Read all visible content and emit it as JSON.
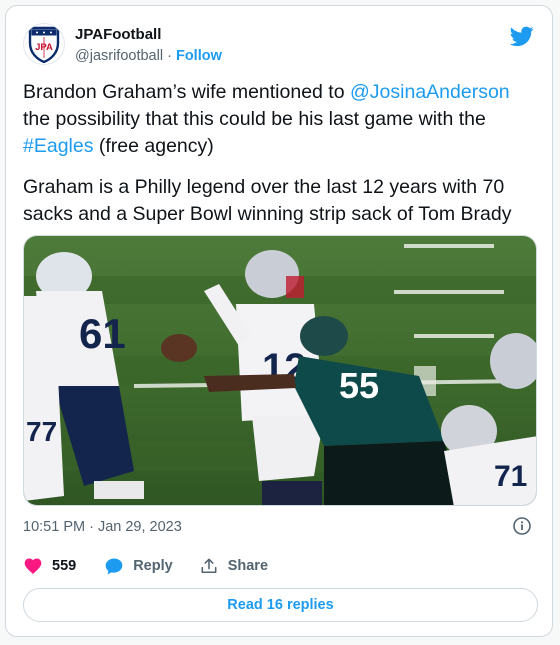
{
  "author": {
    "name": "JPAFootball",
    "handle": "@jasrifootball",
    "separator": "·",
    "follow_label": "Follow",
    "avatar_text": "JPA"
  },
  "tweet": {
    "line1_pre": "Brandon Graham’s wife mentioned to ",
    "mention": "@JosinaAnderson",
    "line1_post": " the possibility that this could be his last game with the ",
    "hashtag": "#Eagles",
    "line1_end": " (free agency)",
    "paragraph2": "Graham is a Philly legend over the last 12 years with 70 sacks and a Super Bowl winning strip sack of Tom Brady"
  },
  "media": {
    "jersey_white_number": "12",
    "jersey_green_number": "55",
    "jersey_left_number": "61",
    "jersey_right_number": "71",
    "jersey_far_left_number": "77"
  },
  "meta": {
    "timestamp": "10:51 PM · Jan 29, 2023"
  },
  "actions": {
    "likes_count": "559",
    "reply_label": "Reply",
    "share_label": "Share"
  },
  "replies_button_label": "Read 16 replies",
  "colors": {
    "accent": "#1d9bf0",
    "like": "#f91880",
    "text": "#0f1419",
    "muted": "#536471",
    "border": "#cfd9de"
  },
  "icons": {
    "brand": "twitter-bird-icon",
    "info": "info-icon",
    "like": "heart-icon",
    "reply": "reply-bubble-icon",
    "share": "share-icon"
  }
}
